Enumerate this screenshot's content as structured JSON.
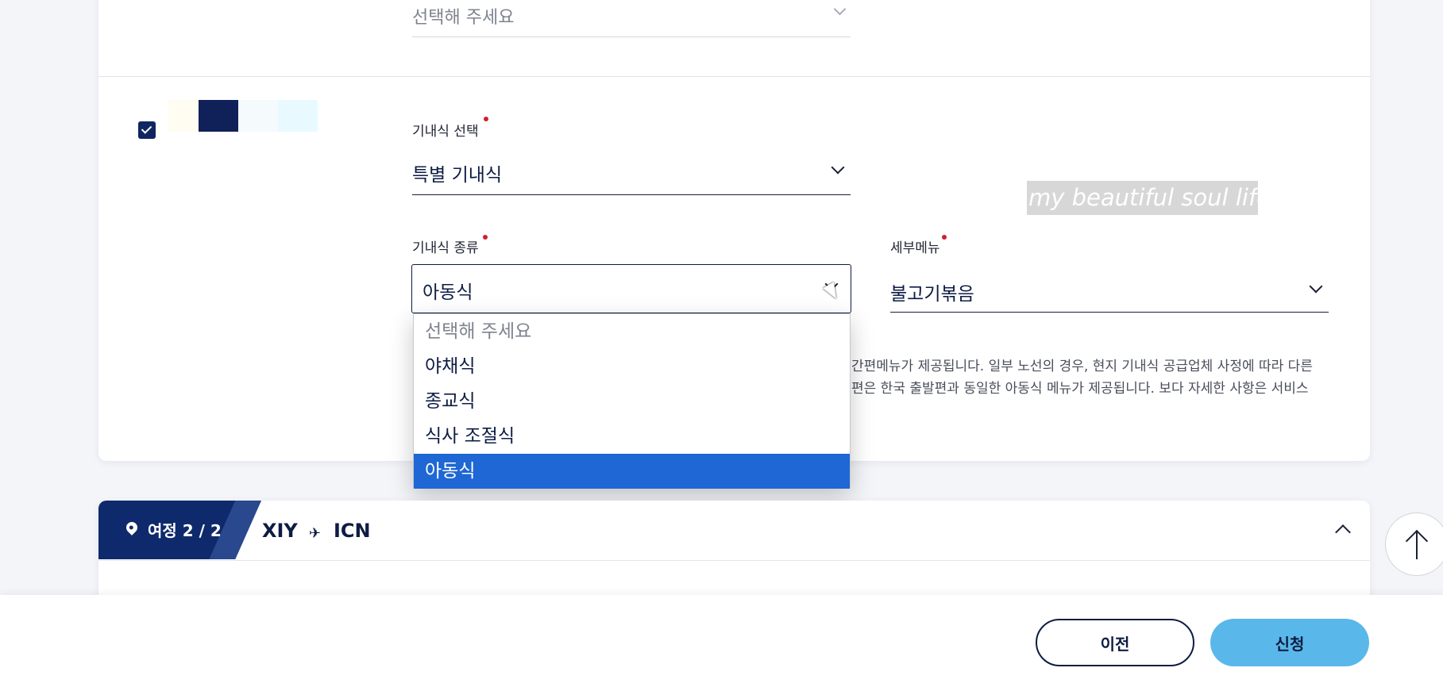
{
  "section1": {
    "select_placeholder": "선택해 주세요"
  },
  "meal": {
    "meal_select_label": "기내식 선택",
    "meal_select_value": "특별 기내식",
    "meal_type_label": "기내식 종류",
    "meal_type_value": "아동식",
    "submenu_label": "세부메뉴",
    "submenu_value": "불고기볶음",
    "notice_line1": "간편메뉴가 제공됩니다. 일부 노선의 경우, 현지 기내식 공급업체 사정에 따라 다른",
    "notice_line2": "편은 한국 출발편과 동일한 아동식 메뉴가 제공됩니다. 보다 자세한 사항은 서비스"
  },
  "dropdown": {
    "options": [
      {
        "label": "선택해 주세요"
      },
      {
        "label": "야채식"
      },
      {
        "label": "종교식"
      },
      {
        "label": "식사 조절식"
      },
      {
        "label": "아동식"
      }
    ]
  },
  "watermark": "my beautiful soul life",
  "itinerary": {
    "tag": "여정 2 / 2",
    "from": "XIY",
    "to": "ICN"
  },
  "footer": {
    "prev_label": "이전",
    "apply_label": "신청"
  },
  "colors": {
    "navy": "#0e1c44",
    "selected_option": "#1e67d4",
    "apply_button": "#59b8e9",
    "required_dot": "#d0202e"
  },
  "icons": [
    "check-icon",
    "chevron-down-icon",
    "location-pin-icon",
    "plane-icon",
    "chevron-up-icon",
    "arrow-up-icon",
    "mouse-cursor-icon"
  ]
}
